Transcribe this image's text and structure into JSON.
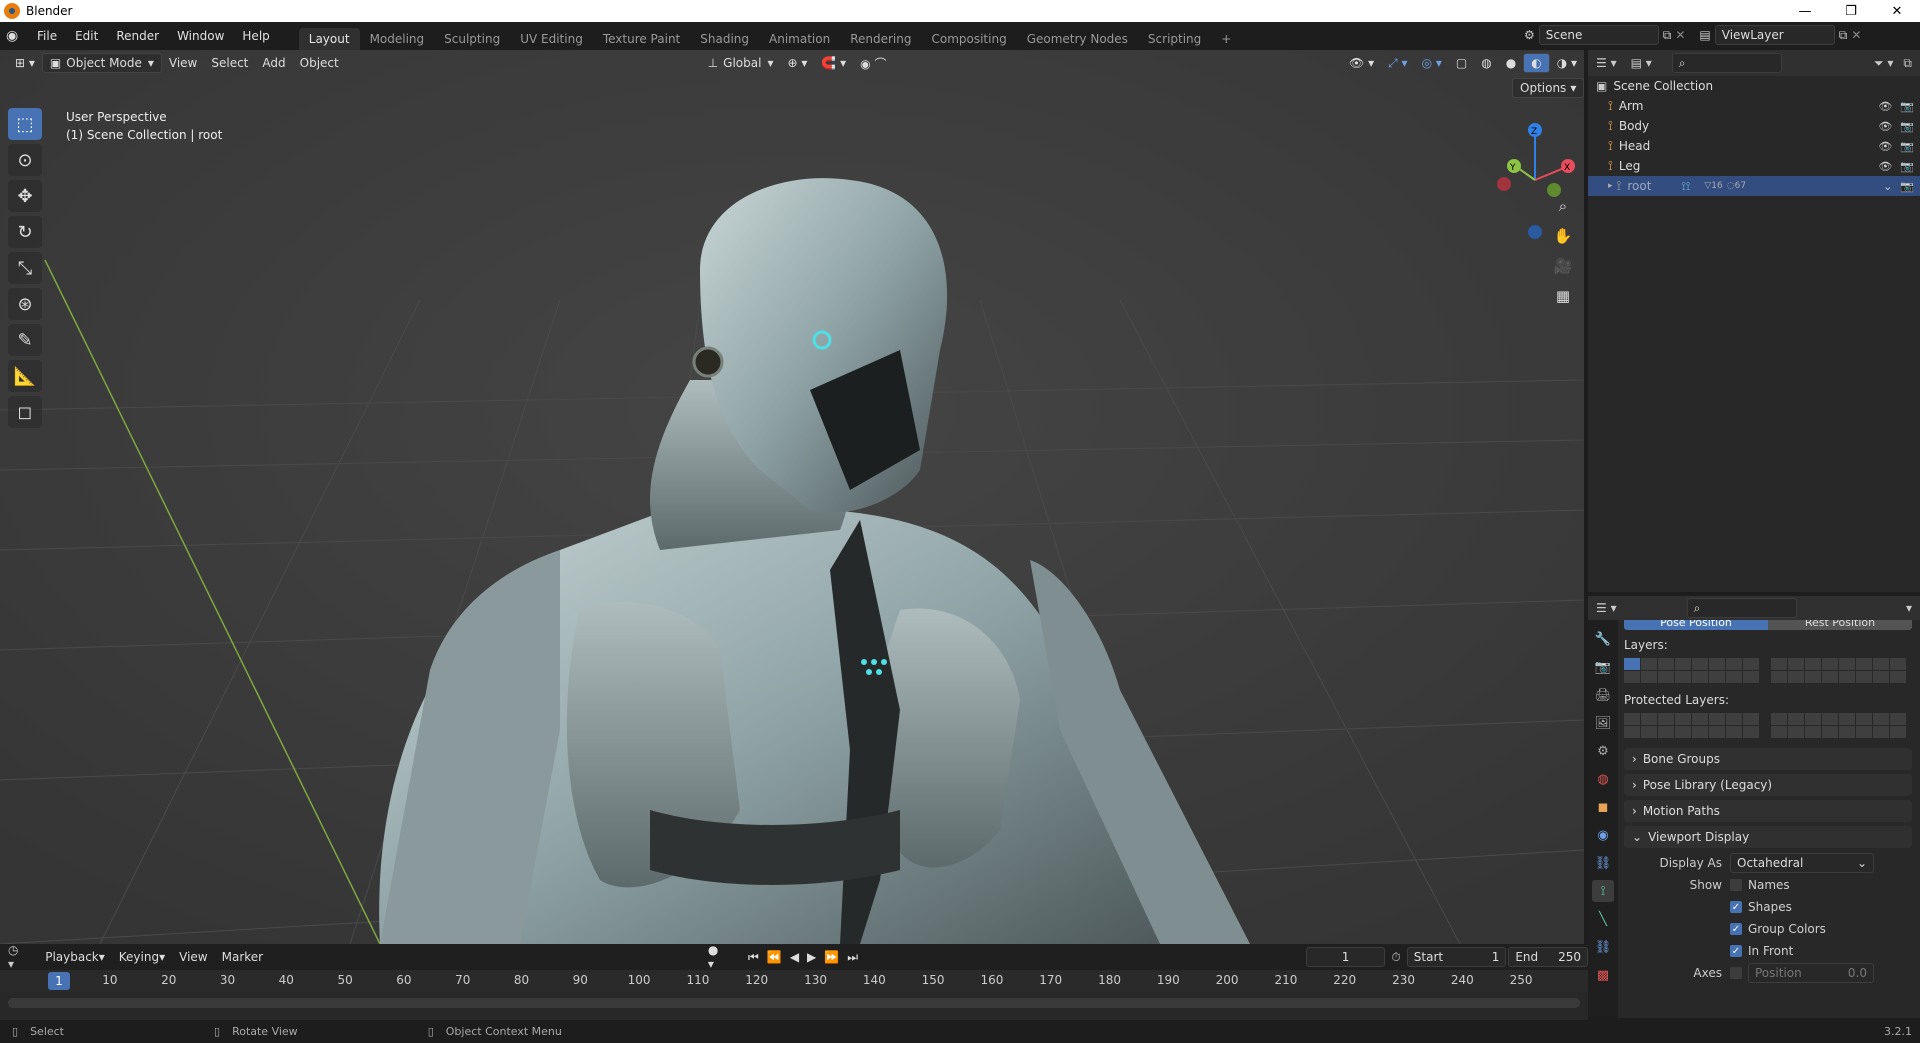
{
  "window": {
    "title": "Blender",
    "min": "—",
    "max": "❐",
    "close": "✕"
  },
  "menu": [
    "File",
    "Edit",
    "Render",
    "Window",
    "Help"
  ],
  "workspaces": [
    "Layout",
    "Modeling",
    "Sculpting",
    "UV Editing",
    "Texture Paint",
    "Shading",
    "Animation",
    "Rendering",
    "Compositing",
    "Geometry Nodes",
    "Scripting"
  ],
  "scene": {
    "scene_name": "Scene",
    "view_layer": "ViewLayer"
  },
  "viewport_header": {
    "mode": "Object Mode",
    "menus": [
      "View",
      "Select",
      "Add",
      "Object"
    ],
    "orientation": "Global",
    "options": "Options"
  },
  "overlay": {
    "perspective": "User Perspective",
    "collection": "(1) Scene Collection | root"
  },
  "gizmo": {
    "x": "X",
    "y": "Y",
    "z": "Z"
  },
  "outliner": {
    "root": "Scene Collection",
    "items": [
      {
        "label": "Arm"
      },
      {
        "label": "Body"
      },
      {
        "label": "Head"
      },
      {
        "label": "Leg"
      },
      {
        "label": "root",
        "badge1": "16",
        "badge2": "67"
      }
    ]
  },
  "properties": {
    "pose_tab": "Pose Position",
    "rest_tab": "Rest Position",
    "layers_label": "Layers:",
    "protected_label": "Protected Layers:",
    "panels": [
      "Bone Groups",
      "Pose Library (Legacy)",
      "Motion Paths"
    ],
    "viewport_display": "Viewport Display",
    "display_as_label": "Display As",
    "display_as_value": "Octahedral",
    "show_label": "Show",
    "show_items": [
      {
        "label": "Names",
        "checked": false
      },
      {
        "label": "Shapes",
        "checked": true
      },
      {
        "label": "Group Colors",
        "checked": true
      },
      {
        "label": "In Front",
        "checked": true
      }
    ],
    "axes_label": "Axes",
    "axes_position_label": "Position",
    "axes_position_value": "0.0"
  },
  "timeline": {
    "menus": [
      "Playback",
      "Keying",
      "View",
      "Marker"
    ],
    "current_frame": "1",
    "start_label": "Start",
    "start_value": "1",
    "end_label": "End",
    "end_value": "250",
    "ticks": [
      "10",
      "20",
      "30",
      "40",
      "50",
      "60",
      "70",
      "80",
      "90",
      "100",
      "110",
      "120",
      "130",
      "140",
      "150",
      "160",
      "170",
      "180",
      "190",
      "200",
      "210",
      "220",
      "230",
      "240",
      "250"
    ]
  },
  "statusbar": {
    "select": "Select",
    "rotate": "Rotate View",
    "context": "Object Context Menu",
    "version": "3.2.1"
  },
  "colors": {
    "accent": "#4772b3",
    "selected_row": "#334d80",
    "bone": "#e8a454"
  }
}
